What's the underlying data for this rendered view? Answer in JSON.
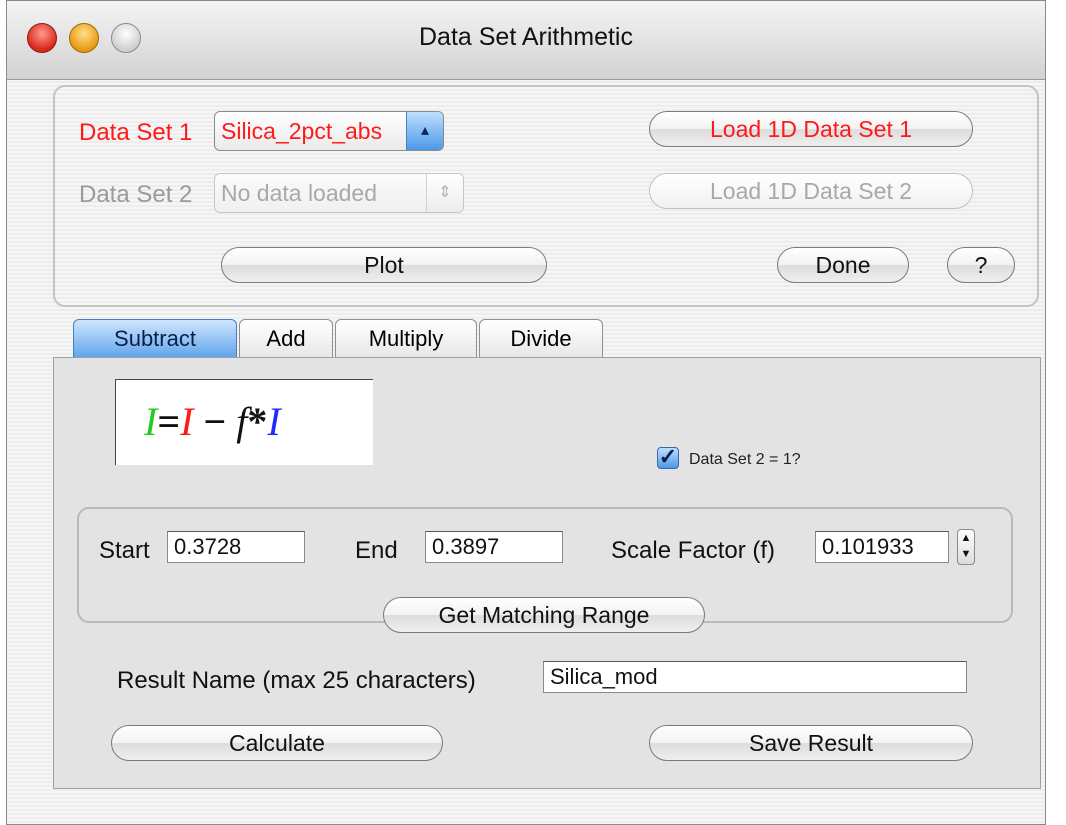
{
  "window": {
    "title": "Data Set Arithmetic"
  },
  "datasets": {
    "ds1_label": "Data Set 1",
    "ds1_value": "Silica_2pct_abs",
    "ds2_label": "Data Set 2",
    "ds2_value": "No data loaded",
    "load1_label": "Load 1D Data Set 1",
    "load2_label": "Load 1D Data Set 2",
    "plot_label": "Plot",
    "done_label": "Done",
    "help_label": "?"
  },
  "tabs": [
    {
      "label": "Subtract",
      "active": true
    },
    {
      "label": "Add",
      "active": false
    },
    {
      "label": "Multiply",
      "active": false
    },
    {
      "label": "Divide",
      "active": false
    }
  ],
  "formula": {
    "lhs": "I",
    "equals": "=",
    "term1": "I",
    "minus": "−",
    "factor": "f",
    "times": "*",
    "term2": "I"
  },
  "checkbox": {
    "label": "Data Set 2 = 1?",
    "checked": true
  },
  "range": {
    "start_label": "Start",
    "start_value": "0.3728",
    "end_label": "End",
    "end_value": "0.3897",
    "scale_label": "Scale Factor (f)",
    "scale_value": "0.101933",
    "match_button": "Get Matching Range"
  },
  "result": {
    "name_label": "Result Name (max 25 characters)",
    "name_value": "Silica_mod",
    "calculate_label": "Calculate",
    "save_label": "Save Result"
  },
  "colors": {
    "ds1_red": "#ff1a1a",
    "result_green": "#22cc22",
    "ds1_formula_red": "#ff1a1a",
    "ds2_blue": "#1a2cff",
    "accent_blue": "#5aa2ea"
  }
}
